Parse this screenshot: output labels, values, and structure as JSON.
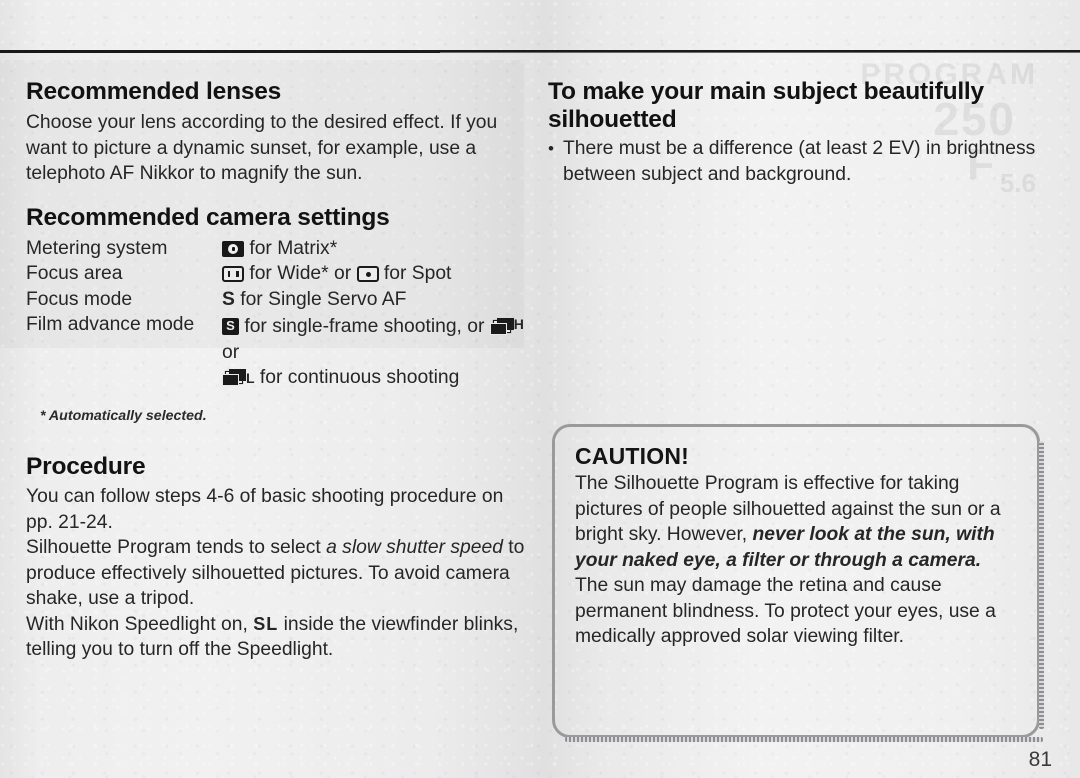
{
  "page": {
    "number": "81"
  },
  "ghost_text": {
    "line_a": "PROGRAM",
    "line_b": "250",
    "line_c": "F",
    "line_d": "5.6"
  },
  "left_column": {
    "lenses": {
      "heading": "Recommended lenses",
      "body": "Choose your lens according to the desired effect. If you want to picture a dynamic sunset, for example, use a telephoto AF Nikkor to magnify the sun."
    },
    "settings": {
      "heading": "Recommended camera settings",
      "rows": [
        {
          "label": "Metering system",
          "icon": "matrix-metering-icon",
          "value_after_icon": " for Matrix*"
        },
        {
          "label": "Focus area",
          "icon": "wide-focus-area-icon",
          "value_after_icon": " for Wide* or ",
          "icon2": "spot-focus-area-icon",
          "value_after_icon2": " for Spot"
        },
        {
          "label": "Focus mode",
          "icon": "single-servo-letter",
          "icon_text": "S",
          "value_after_icon": " for Single Servo AF"
        },
        {
          "label": "Film advance mode",
          "icon": "single-frame-icon",
          "value_after_icon": " for single-frame shooting, or ",
          "icon2": "continuous-high-icon",
          "icon2_suffix": "H",
          "value_after_icon2": " or"
        }
      ],
      "continuation": {
        "icon": "continuous-low-icon",
        "icon_suffix": "L",
        "text": " for continuous shooting"
      },
      "footnote": "* Automatically selected."
    },
    "procedure": {
      "heading": "Procedure",
      "para1": "You can follow steps 4-6 of basic shooting procedure on pp. 21-24.",
      "para2_pre": "Silhouette Program tends to select ",
      "para2_italic": "a slow shutter speed",
      "para2_post": " to produce effectively silhouetted pictures. To avoid camera shake, use a tripod.",
      "para3_pre": "With Nikon Speedlight on, ",
      "para3_lcd": "SL",
      "para3_post": " inside the viewfinder blinks, telling you to turn off the Speedlight."
    }
  },
  "right_column": {
    "silhouette": {
      "heading": "To make your main subject beautifully silhouetted",
      "bullets": [
        "There must be a difference (at least 2 EV) in brightness between subject and background."
      ]
    },
    "caution": {
      "title": "CAUTION!",
      "text_pre": "The Silhouette Program is effective for taking pictures of people silhouetted against the sun or a bright sky. However, ",
      "text_emphasis": "never look at the sun, with your naked eye, a filter or through a camera.",
      "text_post": " The sun may damage the retina and cause permanent blindness. To protect your eyes, use a medically approved solar viewing filter."
    }
  },
  "colors": {
    "paper": "#ececed",
    "ink": "#1c1c1c",
    "rule": "#1a1a1a",
    "caution_border": "#9a9a9d"
  }
}
